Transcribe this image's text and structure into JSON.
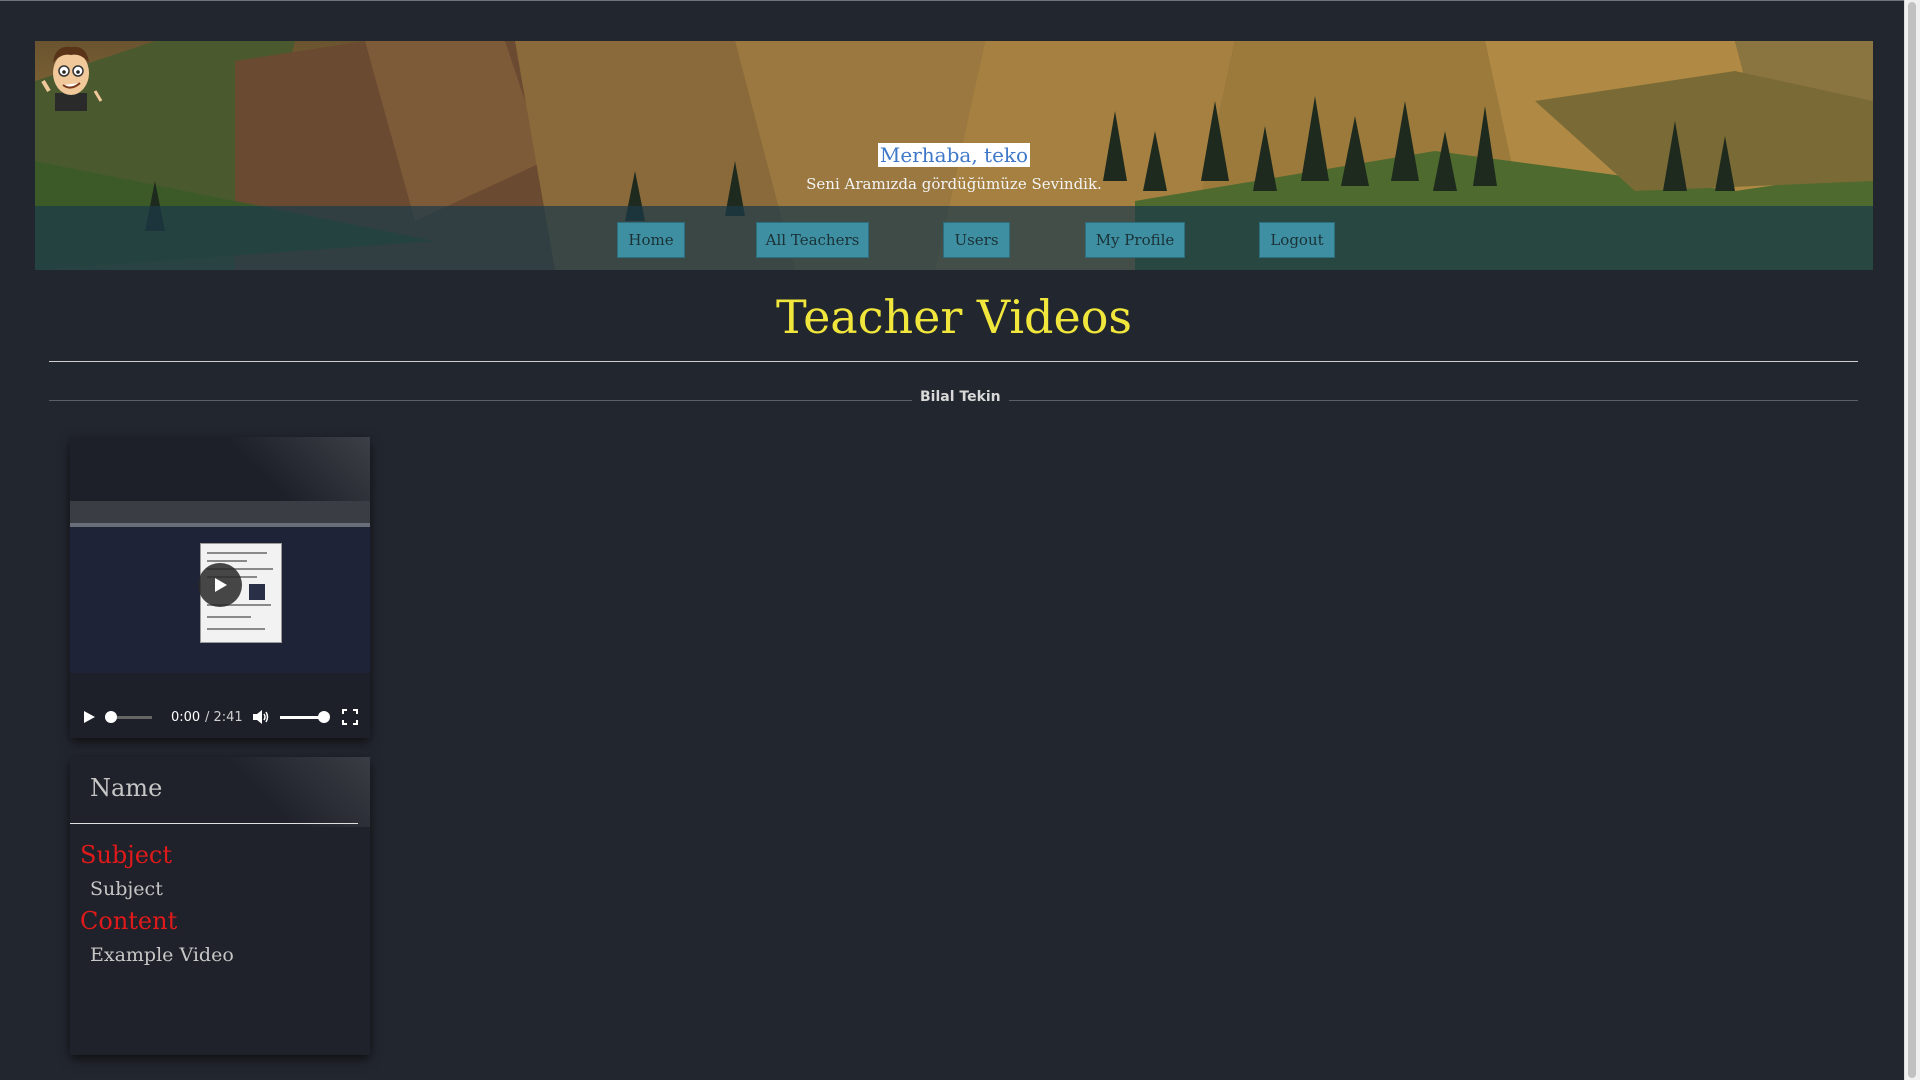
{
  "header": {
    "greeting": "Merhaba, teko",
    "subtitle": "Seni Aramızda gördüğümüze Sevindik."
  },
  "nav": {
    "items": [
      {
        "label": "Home"
      },
      {
        "label": "All Teachers"
      },
      {
        "label": "Users"
      },
      {
        "label": "My Profile"
      },
      {
        "label": "Logout"
      }
    ]
  },
  "page": {
    "title": "Teacher Videos",
    "teacher_name": "Bilal Tekin"
  },
  "video": {
    "current_time": "0:00",
    "duration": "/ 2:41",
    "progress": 0,
    "volume": 1
  },
  "card": {
    "name": "Name",
    "subject_label": "Subject",
    "subject_value": "Subject",
    "content_label": "Content",
    "content_value": "Example Video"
  },
  "colors": {
    "title": "#f0e63c",
    "nav_button": "#3e8fa2",
    "label_red": "#e01a1a",
    "background": "#22262e"
  }
}
